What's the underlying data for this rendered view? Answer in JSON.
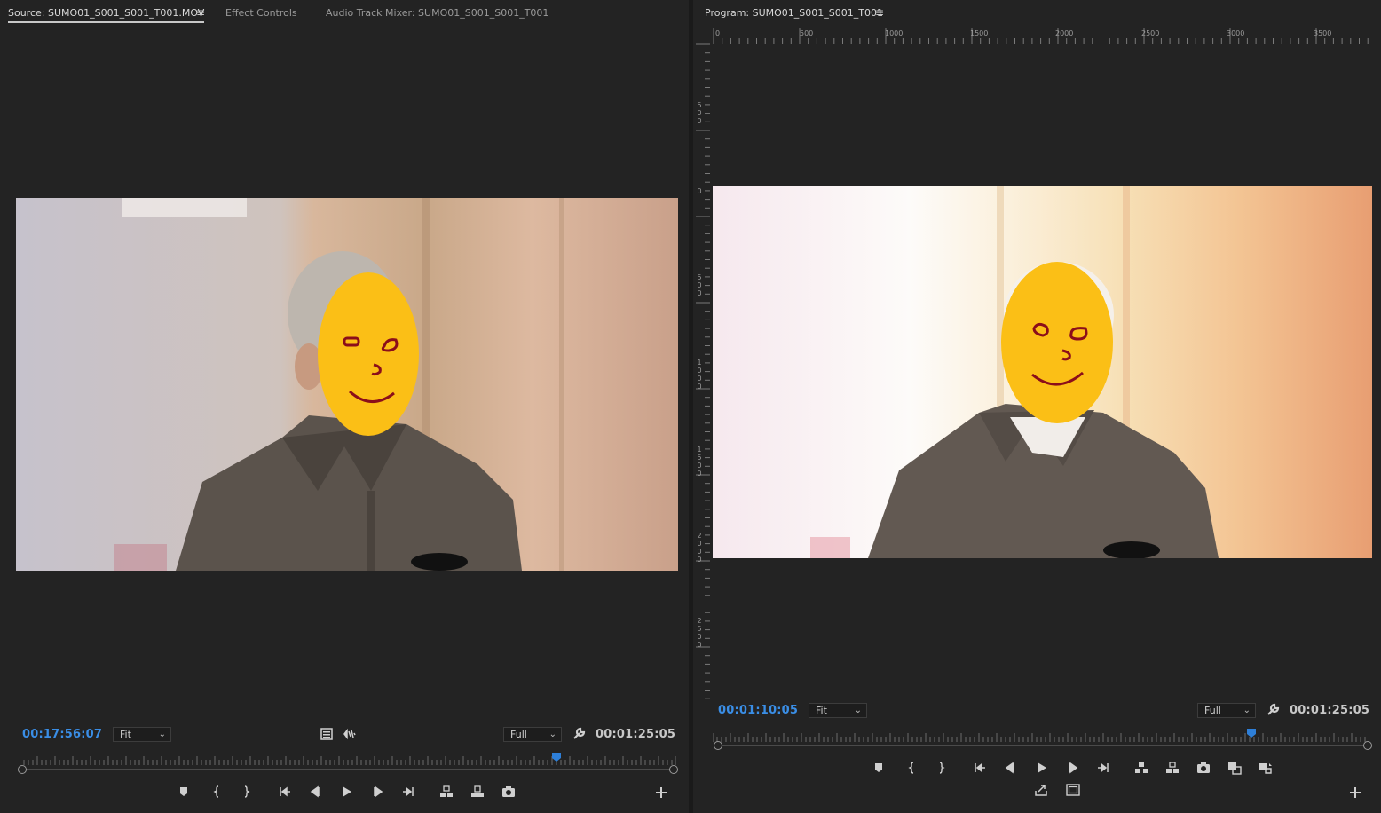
{
  "source_monitor": {
    "tabs": [
      {
        "label": "Source: SUMO01_S001_S001_T001.MOV",
        "active": true
      },
      {
        "label": "Effect Controls",
        "active": false
      },
      {
        "label": "Audio Track Mixer: SUMO01_S001_S001_T001",
        "active": false
      }
    ],
    "menu_icon": "hamburger-menu-icon",
    "playhead_timecode": "00:17:56:07",
    "zoom": "Fit",
    "resolution": "Full",
    "duration": "00:01:25:05",
    "playhead_position": 0.82,
    "buttons": [
      "add-marker-icon",
      "mark-in-icon",
      "mark-out-icon",
      "go-to-in-icon",
      "step-back-icon",
      "play-icon",
      "step-forward-icon",
      "go-to-out-icon",
      "insert-icon",
      "overwrite-icon",
      "export-frame-icon",
      "add-button-icon"
    ],
    "drag_icons": [
      "drag-video-icon",
      "drag-audio-icon"
    ]
  },
  "program_monitor": {
    "title": "Program: SUMO01_S001_S001_T001",
    "menu_icon": "hamburger-menu-icon",
    "playhead_timecode": "00:01:10:05",
    "zoom": "Fit",
    "resolution": "Full",
    "duration": "00:01:25:05",
    "playhead_position": 0.82,
    "ruler_h_labels": [
      "0",
      "500",
      "1000",
      "1500",
      "2000",
      "2500",
      "3000",
      "3500"
    ],
    "ruler_v_labels": [
      "500",
      "0",
      "500",
      "1000",
      "1500",
      "2000",
      "2500"
    ],
    "buttons": [
      "add-marker-icon",
      "mark-in-icon",
      "mark-out-icon",
      "go-to-in-icon",
      "step-back-icon",
      "play-icon",
      "step-forward-icon",
      "go-to-out-icon",
      "lift-icon",
      "extract-icon",
      "export-frame-icon",
      "comparison-view-icon",
      "proxy-toggle-icon",
      "export-icon",
      "safe-margins-icon",
      "add-button-icon"
    ]
  },
  "colors": {
    "panel_bg": "#232323",
    "timecode_blue": "#3a8ee6",
    "playhead_blue": "#2e7fd8",
    "face_fill": "#fbbf16",
    "face_stroke": "#8b0e1a"
  }
}
